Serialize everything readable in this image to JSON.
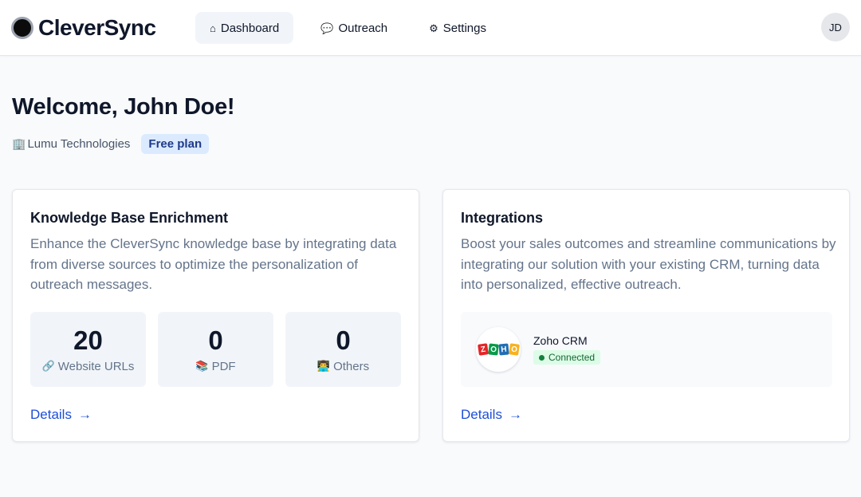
{
  "header": {
    "brand": "CleverSync",
    "nav": [
      {
        "icon": "⌂",
        "label": "Dashboard",
        "active": true
      },
      {
        "icon": "💬",
        "label": "Outreach",
        "active": false
      },
      {
        "icon": "⚙",
        "label": "Settings",
        "active": false
      }
    ],
    "avatar_initials": "JD"
  },
  "welcome": {
    "title": "Welcome, John Doe!",
    "company_icon": "🏢",
    "company": "Lumu Technologies",
    "plan": "Free plan"
  },
  "knowledge_card": {
    "title": "Knowledge Base Enrichment",
    "description": "Enhance the CleverSync knowledge base by integrating data from diverse sources to optimize the personalization of outreach messages.",
    "stats": [
      {
        "value": "20",
        "icon": "🔗",
        "label": "Website URLs"
      },
      {
        "value": "0",
        "icon": "📚",
        "label": "PDF"
      },
      {
        "value": "0",
        "icon": "👨‍💻",
        "label": "Others"
      }
    ],
    "details_label": "Details",
    "arrow": "→"
  },
  "integrations_card": {
    "title": "Integrations",
    "description": "Boost your sales outcomes and streamline communications by integrating our solution with your existing CRM, turning data into personalized, effective outreach.",
    "integration": {
      "logo_letters": [
        "Z",
        "O",
        "H",
        "O"
      ],
      "name": "Zoho CRM",
      "status": "Connected",
      "status_color": "#15803d"
    },
    "details_label": "Details",
    "arrow": "→"
  },
  "colors": {
    "accent": "#1d4ed8",
    "plan_badge_bg": "#dbeafe",
    "background": "#f8fafc"
  }
}
